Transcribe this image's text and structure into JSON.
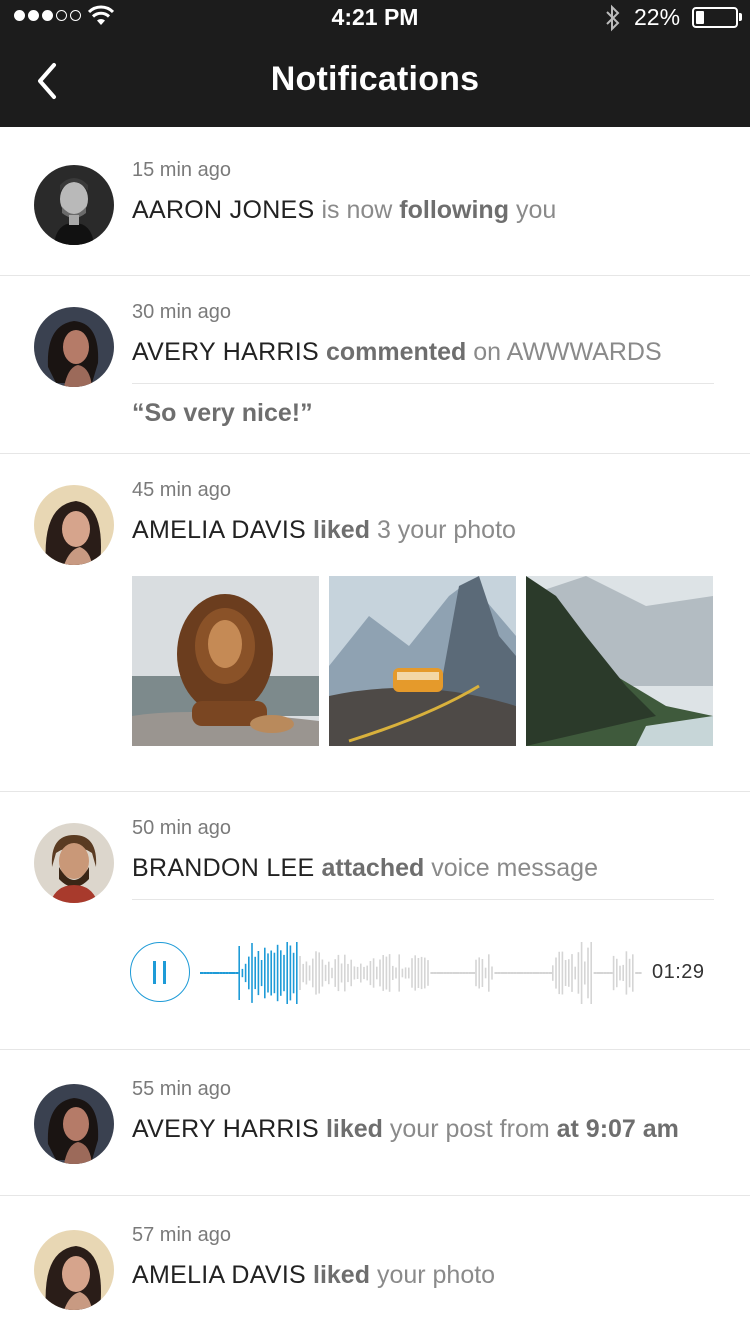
{
  "status": {
    "time": "4:21 PM",
    "battery": "22%",
    "battery_level": 0.22
  },
  "header": {
    "title": "Notifications"
  },
  "notifications": [
    {
      "ago": "15 min ago",
      "name": "AARON JONES",
      "pre": "is now",
      "action": "following",
      "post": "you"
    },
    {
      "ago": "30 min ago",
      "name": "AVERY HARRIS",
      "pre": "",
      "action": "commented",
      "post": "on AWWWARDS",
      "quote": "“So very nice!”"
    },
    {
      "ago": "45 min ago",
      "name": "AMELIA DAVIS",
      "pre": "",
      "action": "liked",
      "post": "3 your photo"
    },
    {
      "ago": "50 min ago",
      "name": "BRANDON LEE",
      "pre": "",
      "action": "attached",
      "post": "voice message",
      "duration": "01:29",
      "progress": 0.22
    },
    {
      "ago": "55 min ago",
      "name": "AVERY HARRIS",
      "pre": "",
      "action": "liked",
      "post": "your post from",
      "post_bold": "at 9:07 am"
    },
    {
      "ago": "57 min ago",
      "name": "AMELIA DAVIS",
      "pre": "",
      "action": "liked",
      "post": "your photo"
    }
  ],
  "colors": {
    "accent": "#1e9bd7",
    "topbar": "#1c1c1c"
  }
}
